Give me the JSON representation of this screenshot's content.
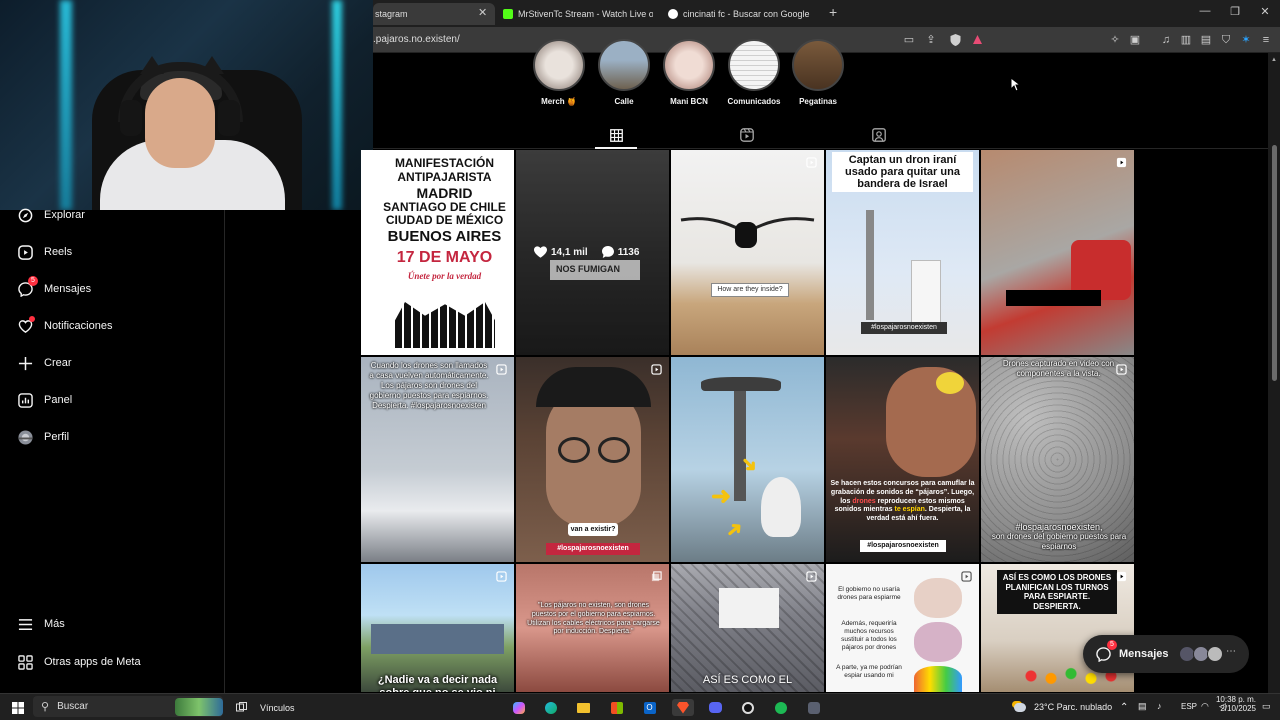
{
  "browser": {
    "tabs": [
      {
        "title": "stagram",
        "color": "#3a3a3a"
      },
      {
        "title": "MrStivenTc Stream - Watch Live on K",
        "color": "#53fc18"
      },
      {
        "title": "cincinati fc - Buscar con Google",
        "color": "#ffffff"
      }
    ],
    "new_tab": "+",
    "url": ".pajaros.no.existen/"
  },
  "highlights": [
    "Merch 🍯",
    "Calle",
    "Mani BCN",
    "Comunicados",
    "Pegatinas"
  ],
  "sidebar": {
    "items": [
      {
        "label": "Explorar",
        "icon": "compass-icon"
      },
      {
        "label": "Reels",
        "icon": "reels-icon"
      },
      {
        "label": "Mensajes",
        "icon": "messenger-icon",
        "badge": "5"
      },
      {
        "label": "Notificaciones",
        "icon": "heart-icon",
        "dot": true
      },
      {
        "label": "Crear",
        "icon": "plus-icon"
      },
      {
        "label": "Panel",
        "icon": "chart-icon"
      },
      {
        "label": "Perfil",
        "icon": "avatar"
      }
    ],
    "more": "Más",
    "meta_apps": "Otras apps de Meta"
  },
  "posts": {
    "p1": {
      "lines": [
        "MANIFESTACIÓN",
        "ANTIPAJARISTA",
        "MADRID",
        "SANTIAGO DE CHILE",
        "CIUDAD DE MÉXICO",
        "BUENOS AIRES",
        "17 DE MAYO"
      ],
      "script": "Únete por la verdad"
    },
    "p2": {
      "likes": "14,1 mil",
      "comments": "1136",
      "sign": "NOS FUMIGAN"
    },
    "p3": {
      "sign": "How are they inside?"
    },
    "p4": {
      "caption": "Captan un dron iraní usado para quitar una bandera de Israel",
      "tag": "#lospajarosnoexisten"
    },
    "p6": {
      "caption": "Cuando los drones son llamados a casa vuelven automáticamente. Los pájaros son drones del gobierno puestos para espiarnos. Despierta. #lospajarosnoexisten"
    },
    "p7": {
      "bubble": "van a existir?",
      "tag": "#lospajarosnoexisten"
    },
    "p9": {
      "caption_pre": "Se hacen estos concursos para camuflar la grabación de sonidos de “pájaros”. Luego, los",
      "hl1": "drones",
      "caption_mid": "reproducen estos mismos sonidos mientras",
      "hl2": "te espían",
      "caption_post": ". Despierta, la verdad está ahí fuera.",
      "tag": "#lospajarosnoexisten"
    },
    "p10": {
      "caption": "Drones capturado en video con componentes a la vista.",
      "tag": "#lospajarosnoexisten,",
      "caption2": "son drones del gobierno puestos para espiarnos"
    },
    "p11": {
      "caption": "¿Nadie va a decir nada sobre que no se vio ni"
    },
    "p12": {
      "caption": "\"Los pájaros no existen, son drones puestos por el gobierno para espiarnos. Utilizan los cables eléctricos para cargarse por inducción. Despierta.\""
    },
    "p13": {
      "caption": "ASÍ ES COMO EL"
    },
    "p14": {
      "line1": "El gobierno no usaría drones para espiarme",
      "line2": "Además, requeriría muchos recursos sustituir a todos los pájaros por drones",
      "line3": "A parte, ya me podrían espiar usando mi"
    },
    "p15": {
      "caption": "ASÍ ES COMO LOS DRONES PLANIFICAN LOS TURNOS PARA ESPIARTE. DESPIERTA."
    }
  },
  "messages_fab": {
    "label": "Mensajes",
    "badge": "5"
  },
  "taskbar": {
    "search": "Buscar",
    "links": "Vínculos",
    "weather": "23°C  Parc. nublado",
    "lang": "ESP",
    "time": "10:38 p. m.",
    "date": "2/10/2025"
  },
  "colors": {
    "accent_red": "#ff3040",
    "link_pink": "#e83e6c",
    "yellow": "#ffd400",
    "tag_bg": "#c4263f"
  }
}
